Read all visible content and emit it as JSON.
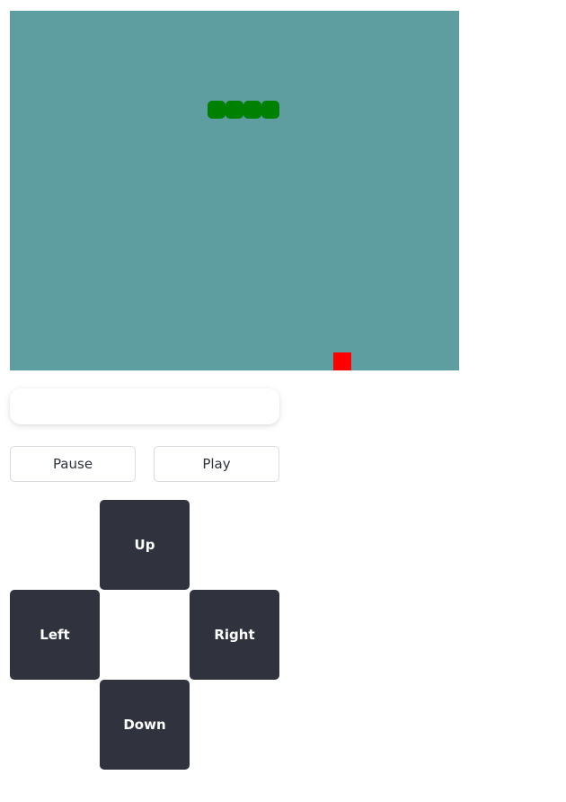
{
  "board": {
    "background": "#5f9ea0",
    "cols": 25,
    "rows": 20
  },
  "snake": {
    "color": "#008000",
    "segments": [
      {
        "col": 11,
        "row": 5
      },
      {
        "col": 12,
        "row": 5
      },
      {
        "col": 13,
        "row": 5
      },
      {
        "col": 14,
        "row": 5
      }
    ]
  },
  "food": {
    "color": "#ff0000",
    "col": 18,
    "row": 19
  },
  "score_panel": {
    "text": ""
  },
  "controls": {
    "pause_label": "Pause",
    "play_label": "Play"
  },
  "dpad": {
    "up_label": "Up",
    "left_label": "Left",
    "right_label": "Right",
    "down_label": "Down"
  }
}
